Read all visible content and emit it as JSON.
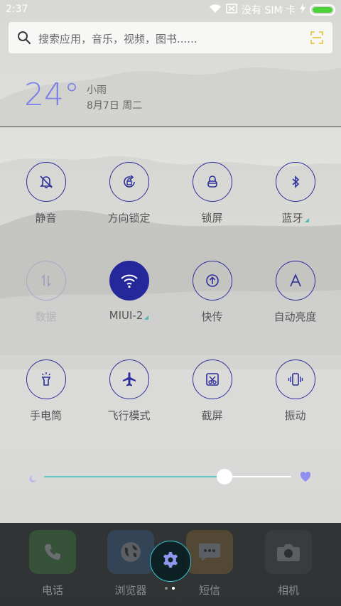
{
  "status_bar": {
    "time": "2:37",
    "sim_status": "没有 SIM 卡",
    "battery_level": 1.0,
    "battery_color": "#4cd33a"
  },
  "search": {
    "placeholder": "搜索应用，音乐，视频，图书......",
    "icon": "search-icon",
    "scan_icon": "scan-icon"
  },
  "weather": {
    "temperature": "24°",
    "condition": "小雨",
    "date": "8月7日 周二"
  },
  "toggles": [
    {
      "label": "静音",
      "icon": "mute-bell-icon",
      "state": "off"
    },
    {
      "label": "方向锁定",
      "icon": "rotation-lock-icon",
      "state": "off"
    },
    {
      "label": "锁屏",
      "icon": "lock-screen-icon",
      "state": "off"
    },
    {
      "label": "蓝牙",
      "icon": "bluetooth-icon",
      "state": "off"
    },
    {
      "label": "数据",
      "icon": "mobile-data-icon",
      "state": "disabled"
    },
    {
      "label": "MIUI-2",
      "icon": "wifi-icon",
      "state": "on"
    },
    {
      "label": "快传",
      "icon": "quick-transfer-icon",
      "state": "off"
    },
    {
      "label": "自动亮度",
      "icon": "auto-brightness-icon",
      "state": "off"
    },
    {
      "label": "手电筒",
      "icon": "flashlight-icon",
      "state": "off"
    },
    {
      "label": "飞行模式",
      "icon": "airplane-icon",
      "state": "off"
    },
    {
      "label": "截屏",
      "icon": "screenshot-icon",
      "state": "off"
    },
    {
      "label": "振动",
      "icon": "vibrate-icon",
      "state": "off"
    }
  ],
  "brightness": {
    "value": 0.73,
    "track_color": "#5fc7c7",
    "min_icon": "brightness-low-icon",
    "max_icon": "brightness-high-icon"
  },
  "dock": {
    "apps": [
      {
        "label": "电话",
        "icon": "phone-icon",
        "color": "#4fc04f"
      },
      {
        "label": "浏览器",
        "icon": "browser-icon",
        "color": "#3b8ef0"
      },
      {
        "label": "短信",
        "icon": "message-icon",
        "color": "#f3a83a"
      },
      {
        "label": "相机",
        "icon": "camera-icon",
        "color": "#4a4d52"
      }
    ],
    "settings_icon": "settings-gear-icon",
    "page_indicator": {
      "count": 2,
      "current": 1
    },
    "accent": "#35c6d2"
  }
}
